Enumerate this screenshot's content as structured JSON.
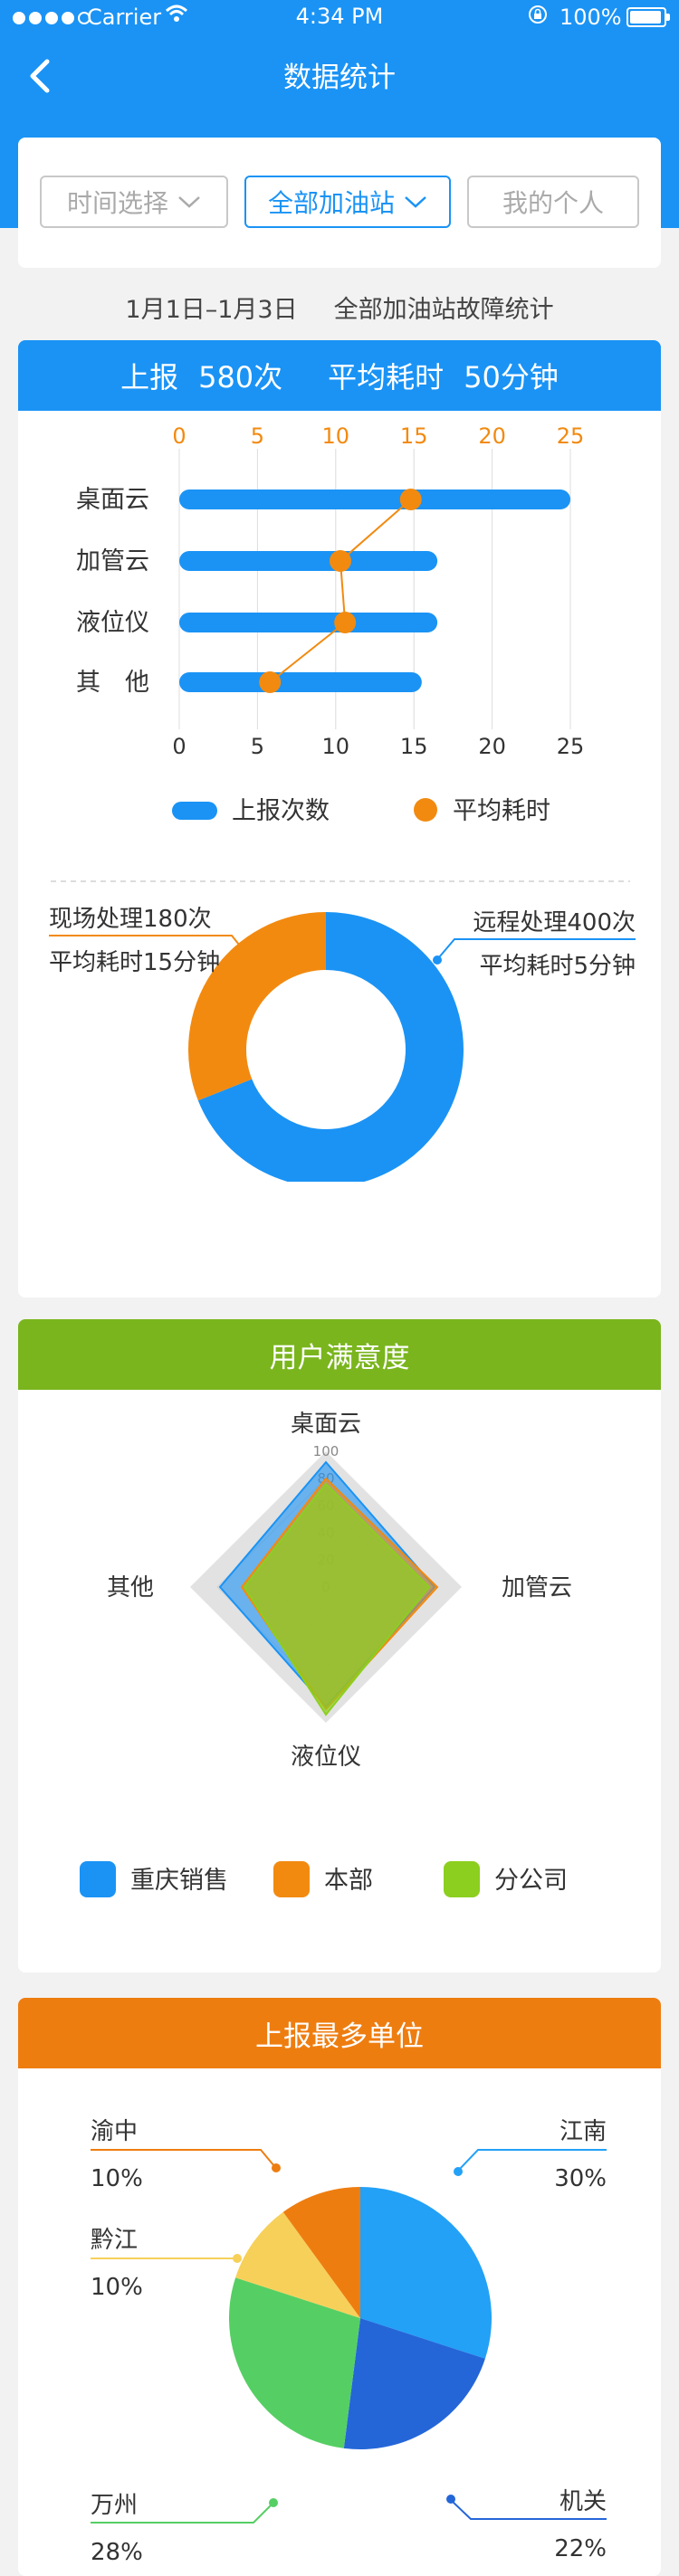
{
  "status_bar": {
    "carrier": "Carrier",
    "time": "4:34 PM",
    "battery": "100%"
  },
  "header": {
    "title": "数据统计"
  },
  "filters": [
    {
      "label": "时间选择",
      "active": false
    },
    {
      "label": "全部加油站",
      "active": true
    },
    {
      "label": "我的个人",
      "active": false
    }
  ],
  "summary": {
    "date_range": "1月1日–1月3日",
    "caption": "全部加油站故障统计"
  },
  "report_stats": {
    "count_label": "上报",
    "count_value": "580次",
    "avg_label": "平均耗时",
    "avg_value": "50分钟"
  },
  "colors": {
    "blue": "#1a93f5",
    "orange": "#f28a10",
    "green": "#7ab51d",
    "unit_orange": "#ee7d10"
  },
  "chart_data": [
    {
      "type": "bar",
      "orientation": "horizontal",
      "categories": [
        "桌面云",
        "加管云",
        "液位仪",
        "其　他"
      ],
      "series": [
        {
          "name": "上报次数",
          "values": [
            25,
            16.5,
            16.5,
            15.5
          ]
        },
        {
          "name": "平均耗时",
          "values": [
            14.8,
            10.3,
            10.6,
            5.8
          ]
        }
      ],
      "xlim": [
        0,
        25
      ],
      "ticks": [
        "0",
        "5",
        "10",
        "15",
        "20",
        "25"
      ],
      "grid": true,
      "legend": "bottom"
    },
    {
      "type": "pie",
      "donut": true,
      "slices": [
        {
          "label": "远程处理400次",
          "sub": "平均耗时5分钟",
          "value": 400
        },
        {
          "label": "现场处理180次",
          "sub": "平均耗时15分钟",
          "value": 180
        }
      ]
    },
    {
      "type": "radar",
      "title": "用户满意度",
      "axes": [
        "桌面云",
        "加管云",
        "液位仪",
        "其他"
      ],
      "ticks": [
        "100",
        "80",
        "60",
        "40",
        "20",
        "0"
      ],
      "rmax": 100,
      "series": [
        {
          "name": "重庆销售",
          "values": [
            92,
            80,
            88,
            78
          ]
        },
        {
          "name": "本部",
          "values": [
            80,
            82,
            90,
            62
          ]
        },
        {
          "name": "分公司",
          "values": [
            76,
            76,
            94,
            60
          ]
        }
      ],
      "legend": "bottom"
    },
    {
      "type": "pie",
      "title": "上报最多单位",
      "slices": [
        {
          "label": "江南",
          "percent": "30%",
          "value": 30
        },
        {
          "label": "机关",
          "percent": "22%",
          "value": 22
        },
        {
          "label": "万州",
          "percent": "28%",
          "value": 28
        },
        {
          "label": "黔江",
          "percent": "10%",
          "value": 10
        },
        {
          "label": "渝中",
          "percent": "10%",
          "value": 10
        }
      ]
    }
  ]
}
